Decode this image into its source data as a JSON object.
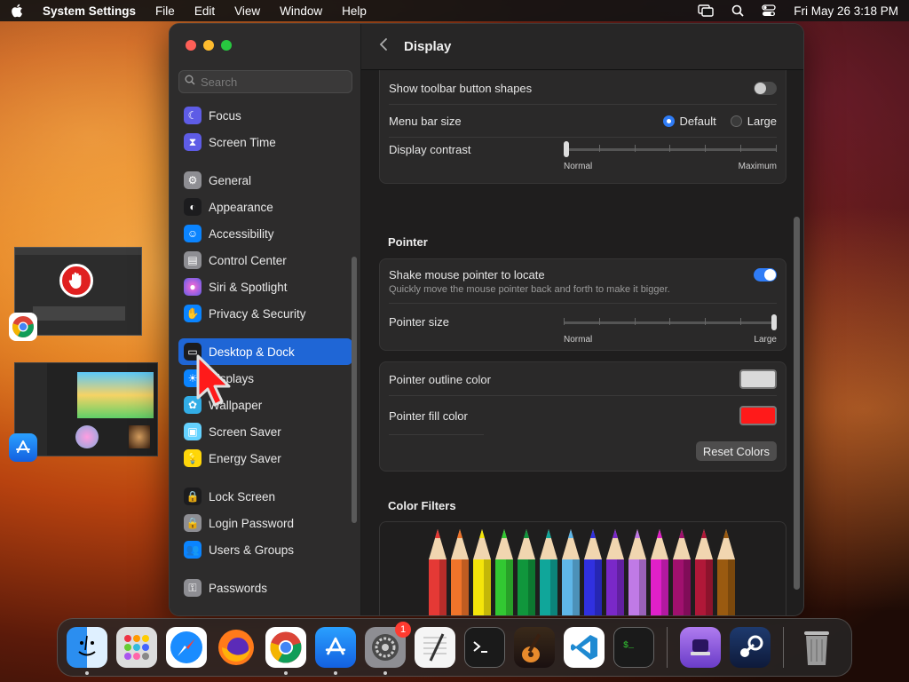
{
  "menubar": {
    "app_name": "System Settings",
    "menus": [
      "File",
      "Edit",
      "View",
      "Window",
      "Help"
    ],
    "datetime": "Fri May 26  3:18 PM"
  },
  "sidebar": {
    "search_placeholder": "Search",
    "items": [
      {
        "label": "Focus",
        "icon": "moon-icon",
        "color": "#5e5ce6"
      },
      {
        "label": "Screen Time",
        "icon": "hourglass-icon",
        "color": "#5e5ce6"
      },
      {
        "label": "General",
        "icon": "gear-icon",
        "color": "#8e8e93"
      },
      {
        "label": "Appearance",
        "icon": "appearance-icon",
        "color": "#1c1c1e"
      },
      {
        "label": "Accessibility",
        "icon": "accessibility-icon",
        "color": "#0a84ff"
      },
      {
        "label": "Control Center",
        "icon": "control-center-icon",
        "color": "#8e8e93"
      },
      {
        "label": "Siri & Spotlight",
        "icon": "siri-icon",
        "color": "#bf5af2"
      },
      {
        "label": "Privacy & Security",
        "icon": "hand-icon",
        "color": "#0a84ff"
      },
      {
        "label": "Desktop & Dock",
        "icon": "dock-icon",
        "color": "#1c1c1e"
      },
      {
        "label": "Displays",
        "icon": "sun-icon",
        "color": "#0a84ff"
      },
      {
        "label": "Wallpaper",
        "icon": "flower-icon",
        "color": "#32ade6"
      },
      {
        "label": "Screen Saver",
        "icon": "screen-saver-icon",
        "color": "#64d2ff"
      },
      {
        "label": "Energy Saver",
        "icon": "bulb-icon",
        "color": "#ffd60a"
      },
      {
        "label": "Lock Screen",
        "icon": "lock-icon",
        "color": "#1c1c1e"
      },
      {
        "label": "Login Password",
        "icon": "lock-icon",
        "color": "#8e8e93"
      },
      {
        "label": "Users & Groups",
        "icon": "users-icon",
        "color": "#0a84ff"
      },
      {
        "label": "Passwords",
        "icon": "key-icon",
        "color": "#8e8e93"
      }
    ]
  },
  "content": {
    "back_label": "‹",
    "title": "Display",
    "show_toolbar_label": "Show toolbar button shapes",
    "show_toolbar_on": false,
    "menu_bar_size_label": "Menu bar size",
    "menu_bar_options": [
      "Default",
      "Large"
    ],
    "menu_bar_selected": "Default",
    "display_contrast_label": "Display contrast",
    "contrast_min": "Normal",
    "contrast_max": "Maximum",
    "contrast_value": 0,
    "pointer_section": "Pointer",
    "shake_label": "Shake mouse pointer to locate",
    "shake_desc": "Quickly move the mouse pointer back and forth to make it bigger.",
    "shake_on": true,
    "pointer_size_label": "Pointer size",
    "size_min": "Normal",
    "size_max": "Large",
    "pointer_size_value": 1,
    "outline_label": "Pointer outline color",
    "outline_color": "#d9d9d9",
    "fill_label": "Pointer fill color",
    "fill_color": "#ff1a1a",
    "reset_label": "Reset Colors",
    "color_filters_section": "Color Filters"
  },
  "pencil_colors": [
    "#e53935",
    "#f0742a",
    "#f5e50a",
    "#32c832",
    "#10963c",
    "#10a69a",
    "#5fb6e8",
    "#3030e0",
    "#7a28c8",
    "#c07ae6",
    "#e020c8",
    "#a0106e",
    "#b01838",
    "#9a5a10"
  ],
  "dock": {
    "apps": [
      {
        "name": "finder-icon",
        "running": true
      },
      {
        "name": "launchpad-icon",
        "running": false
      },
      {
        "name": "safari-icon",
        "running": false
      },
      {
        "name": "firefox-icon",
        "running": false
      },
      {
        "name": "chrome-icon",
        "running": true
      },
      {
        "name": "app-store-icon",
        "running": true
      },
      {
        "name": "system-settings-icon",
        "running": true,
        "badge": "1"
      },
      {
        "name": "textedit-icon",
        "running": false
      },
      {
        "name": "terminal-icon",
        "running": false
      },
      {
        "name": "garageband-icon",
        "running": false
      },
      {
        "name": "vscode-icon",
        "running": false
      },
      {
        "name": "activity-terminal-icon",
        "running": false
      }
    ],
    "extra": [
      "podcast-disk-icon",
      "steam-icon"
    ],
    "trash": "trash-icon"
  }
}
